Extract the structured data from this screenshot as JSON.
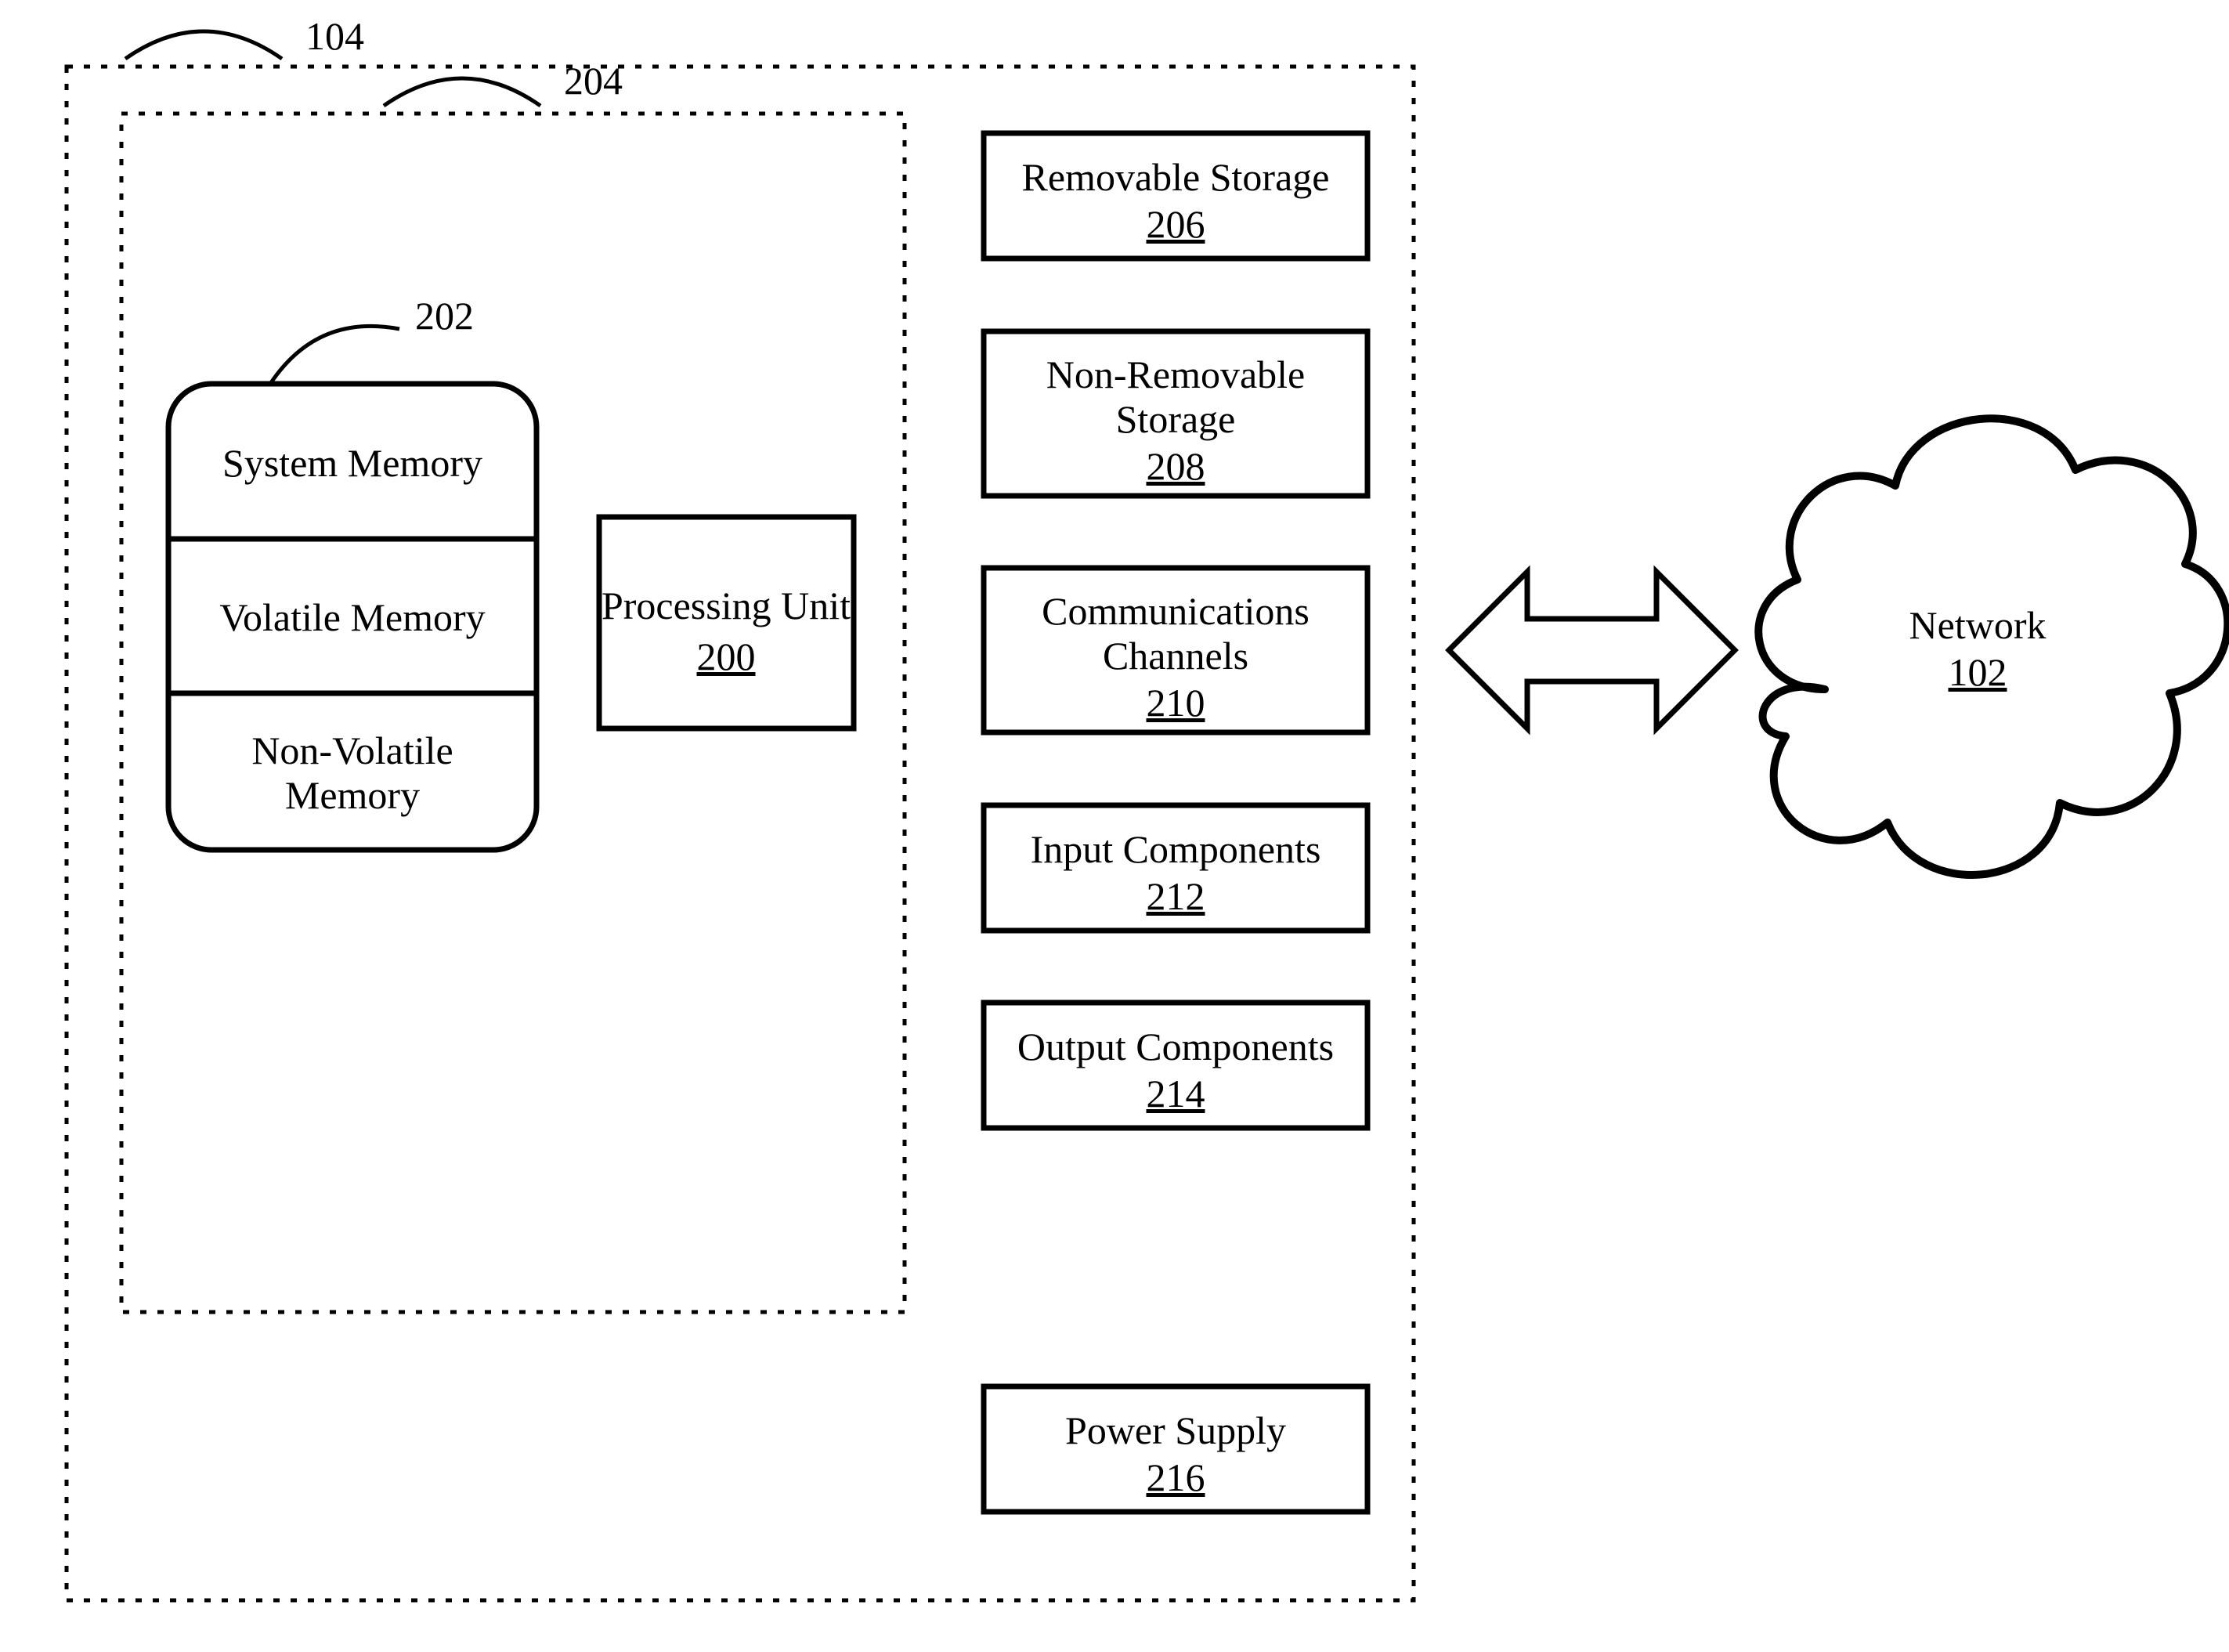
{
  "refs": {
    "outer": "104",
    "inner": "204",
    "memory": "202"
  },
  "memory": {
    "system": "System Memory",
    "volatile": "Volatile Memory",
    "nonvolatile_l1": "Non-Volatile",
    "nonvolatile_l2": "Memory"
  },
  "processing": {
    "label": "Processing Unit",
    "num": "200"
  },
  "blocks": {
    "removable": {
      "label": "Removable Storage",
      "num": "206"
    },
    "nonremovable": {
      "l1": "Non-Removable",
      "l2": "Storage",
      "num": "208"
    },
    "comm": {
      "l1": "Communications",
      "l2": "Channels",
      "num": "210"
    },
    "input": {
      "label": "Input Components",
      "num": "212"
    },
    "output": {
      "label": "Output Components",
      "num": "214"
    },
    "power": {
      "label": "Power Supply",
      "num": "216"
    }
  },
  "network": {
    "label": "Network",
    "num": "102"
  }
}
